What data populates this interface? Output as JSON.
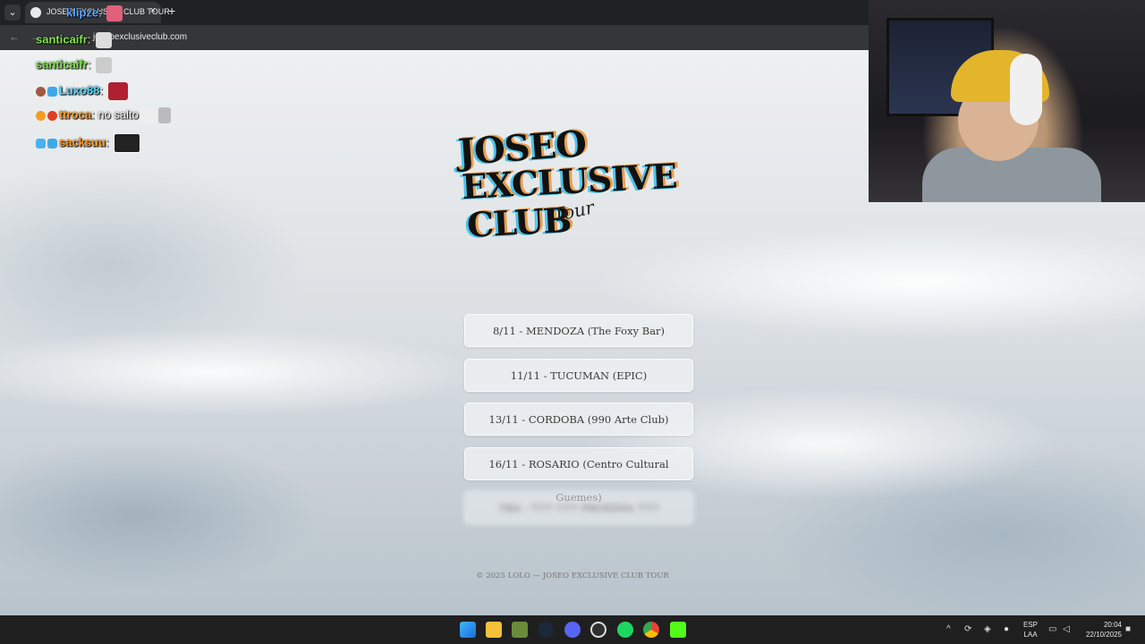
{
  "browser": {
    "tab_title": "JOSEO EXCLUSIVE CLUB TOUR",
    "close_glyph": "×",
    "new_tab_glyph": "+",
    "menu_glyph": "⌄",
    "back_glyph": "←",
    "forward_glyph": "→",
    "url": "joseoexclusiveclub.com"
  },
  "page": {
    "logo_lines": [
      "JOSEO",
      "EXCLUSIVE",
      "CLUB"
    ],
    "logo_script": "Tour",
    "dates": [
      {
        "label": "8/11 - MENDOZA (The Foxy Bar)"
      },
      {
        "label": "11/11 - TUCUMAN (EPIC)"
      },
      {
        "label": "13/11 - CORDOBA (990 Arte Club)"
      },
      {
        "label": "16/11 - ROSARIO (Centro Cultural Guemes)"
      }
    ],
    "blurred_date": "TBA - ???? ???? PRÓXIMA ????",
    "footer": "© 2025 LOLO — JOSEO EXCLUSIVE CLUB TOUR"
  },
  "chat": [
    {
      "user": "klipze",
      "message": "",
      "color": "#5aa8ff"
    },
    {
      "user": "santicaifr",
      "message": "",
      "color": "#7fe34a"
    },
    {
      "user": "santicaifr",
      "message": "",
      "color": "#7fe34a"
    },
    {
      "user": "Luxo88",
      "message": "",
      "color": "#4fd7ff"
    },
    {
      "user": "ttroca",
      "message": "no salto",
      "color": "#ff9a1f"
    },
    {
      "user": "sacksuu",
      "message": "",
      "color": "#ff9a1f"
    }
  ],
  "taskbar": {
    "language": "ESP",
    "layout": "LAA",
    "time": "20:04",
    "date": "22/10/2025",
    "tray_up_glyph": "^",
    "icons": [
      "windows-start",
      "file-explorer",
      "minecraft",
      "steam",
      "discord",
      "obs",
      "spotify",
      "chrome",
      "kick"
    ]
  },
  "colors": {
    "taskbar_bg": "#1f1f1f",
    "accent_green": "#53fc18"
  }
}
